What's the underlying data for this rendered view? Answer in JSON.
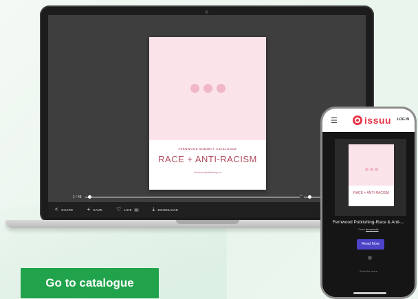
{
  "laptop": {
    "document": {
      "kicker": "FERNWOOD SUBJECT CATALOGUE",
      "title": "RACE + ANTI-RACISM",
      "url": "fernwoodpublishing.ca"
    },
    "progress": {
      "label": "1 / 48",
      "fraction": 0.02
    },
    "toolbar": {
      "share": "SHARE",
      "save": "SAVE",
      "like": "LIKE",
      "like_count": "0",
      "download": "DOWNLOAD"
    }
  },
  "phone": {
    "logo": "issuu",
    "login": "LOG IN",
    "document_title": "RACE + ANTI-RACISM",
    "publication_title": "Fernwood Publishing-Race & Anti-...",
    "from_label": "From",
    "publisher": "fernwoodb",
    "read_button": "Read Now",
    "scroll_hint": "Scroll for more"
  },
  "cta": {
    "label": "Go to catalogue"
  },
  "colors": {
    "accent_green": "#21a34c",
    "issuu_red": "#e8374a",
    "read_button": "#4b44c8",
    "cover_pink": "#fbe3ea",
    "title_rose": "#b24a5e"
  }
}
